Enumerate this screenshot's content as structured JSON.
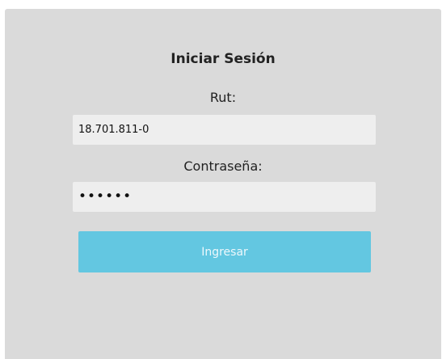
{
  "login": {
    "title": "Iniciar Sesión",
    "rut_label": "Rut:",
    "rut_value": "18.701.811-0",
    "password_label": "Contraseña:",
    "password_value": "••••••",
    "submit_label": "Ingresar"
  },
  "colors": {
    "panel_bg": "#dadada",
    "field_bg": "#eeeeee",
    "button_bg": "#63c7e1",
    "button_text": "#eef8fc"
  }
}
